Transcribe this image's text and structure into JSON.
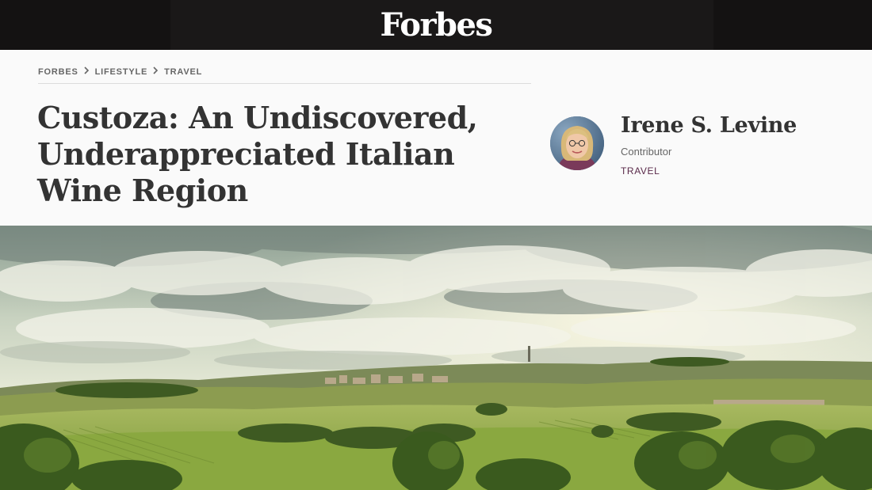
{
  "header": {
    "logo_text": "Forbes"
  },
  "breadcrumb": {
    "items": [
      "FORBES",
      "LIFESTYLE",
      "TRAVEL"
    ]
  },
  "article": {
    "headline": "Custoza: An Undiscovered, Underappreciated Italian Wine Region"
  },
  "author": {
    "name": "Irene S. Levine",
    "role": "Contributor",
    "section": "TRAVEL"
  },
  "icons": {
    "breadcrumb_separator": "chevron-right-icon"
  },
  "colors": {
    "topbar": "#1a1818",
    "section_accent": "#5a2a4a",
    "headline": "#333333"
  }
}
